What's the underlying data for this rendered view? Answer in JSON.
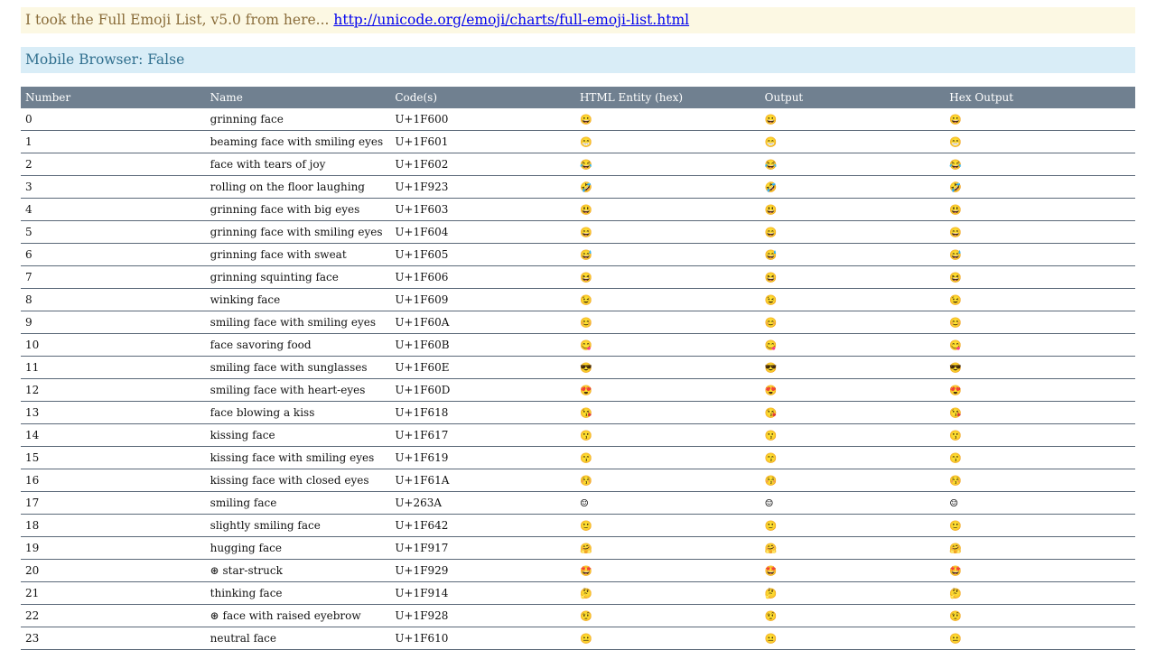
{
  "banner_source": {
    "text": "I took the Full Emoji List, v5.0 from here... ",
    "link_text": "http://unicode.org/emoji/charts/full-emoji-list.html"
  },
  "banner_mobile": {
    "text": "Mobile Browser: False"
  },
  "table": {
    "headers": [
      "Number",
      "Name",
      "Code(s)",
      "HTML Entity (hex)",
      "Output",
      "Hex Output"
    ],
    "rows": [
      {
        "num": "0",
        "name": "grinning face",
        "code": "U+1F600",
        "emoji": "😀"
      },
      {
        "num": "1",
        "name": "beaming face with smiling eyes",
        "code": "U+1F601",
        "emoji": "😁"
      },
      {
        "num": "2",
        "name": "face with tears of joy",
        "code": "U+1F602",
        "emoji": "😂"
      },
      {
        "num": "3",
        "name": "rolling on the floor laughing",
        "code": "U+1F923",
        "emoji": "🤣"
      },
      {
        "num": "4",
        "name": "grinning face with big eyes",
        "code": "U+1F603",
        "emoji": "😃"
      },
      {
        "num": "5",
        "name": "grinning face with smiling eyes",
        "code": "U+1F604",
        "emoji": "😄"
      },
      {
        "num": "6",
        "name": "grinning face with sweat",
        "code": "U+1F605",
        "emoji": "😅"
      },
      {
        "num": "7",
        "name": "grinning squinting face",
        "code": "U+1F606",
        "emoji": "😆"
      },
      {
        "num": "8",
        "name": "winking face",
        "code": "U+1F609",
        "emoji": "😉"
      },
      {
        "num": "9",
        "name": "smiling face with smiling eyes",
        "code": "U+1F60A",
        "emoji": "😊"
      },
      {
        "num": "10",
        "name": "face savoring food",
        "code": "U+1F60B",
        "emoji": "😋"
      },
      {
        "num": "11",
        "name": "smiling face with sunglasses",
        "code": "U+1F60E",
        "emoji": "😎"
      },
      {
        "num": "12",
        "name": "smiling face with heart-eyes",
        "code": "U+1F60D",
        "emoji": "😍"
      },
      {
        "num": "13",
        "name": "face blowing a kiss",
        "code": "U+1F618",
        "emoji": "😘"
      },
      {
        "num": "14",
        "name": "kissing face",
        "code": "U+1F617",
        "emoji": "😗"
      },
      {
        "num": "15",
        "name": "kissing face with smiling eyes",
        "code": "U+1F619",
        "emoji": "😙"
      },
      {
        "num": "16",
        "name": "kissing face with closed eyes",
        "code": "U+1F61A",
        "emoji": "😚"
      },
      {
        "num": "17",
        "name": "smiling face",
        "code": "U+263A",
        "emoji": "☺"
      },
      {
        "num": "18",
        "name": "slightly smiling face",
        "code": "U+1F642",
        "emoji": "🙂"
      },
      {
        "num": "19",
        "name": "hugging face",
        "code": "U+1F917",
        "emoji": "🤗"
      },
      {
        "num": "20",
        "name": "⊛ star-struck",
        "code": "U+1F929",
        "emoji": "🤩"
      },
      {
        "num": "21",
        "name": "thinking face",
        "code": "U+1F914",
        "emoji": "🤔"
      },
      {
        "num": "22",
        "name": "⊛ face with raised eyebrow",
        "code": "U+1F928",
        "emoji": "🤨"
      },
      {
        "num": "23",
        "name": "neutral face",
        "code": "U+1F610",
        "emoji": "😐"
      }
    ]
  }
}
